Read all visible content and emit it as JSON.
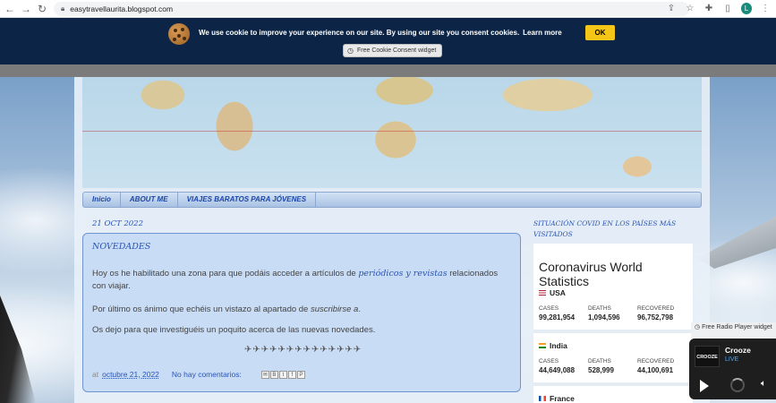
{
  "browser": {
    "url": "easytravellaurita.blogspot.com",
    "profile_initial": "L"
  },
  "cookie": {
    "message": "We use cookie to improve your experience on our site. By using our site you consent cookies.",
    "learn_more": "Learn more",
    "ok_label": "OK",
    "widget_label": "Free Cookie Consent widget"
  },
  "nav": {
    "items": [
      "Inicio",
      "ABOUT ME",
      "VIAJES BARATOS PARA JÓVENES"
    ]
  },
  "post": {
    "date_header": "21 OCT 2022",
    "title": "NOVEDADES",
    "p1_a": "Hoy os he habilitado una zona para que podáis acceder a artículos de ",
    "p1_b": "periódicos y revistas",
    "p1_c": " relacionados con viajar.",
    "p2_a": "Por último os ánimo que echéis un vistazo al apartado de ",
    "p2_b": "suscribirse a",
    "p2_c": ".",
    "p3": "Os dejo para que investiguéis un poquito acerca de las nuevas novedades.",
    "planes": "✈✈✈✈✈✈✈✈✈✈✈✈✈✈",
    "footer_at": "at",
    "footer_date": "octubre 21, 2022",
    "footer_comments": "No hay comentarios:"
  },
  "sidebar": {
    "title": "SITUACIÓN COVID EN LOS PAÍSES MÁS VISITADOS",
    "widget_title": "Coronavirus World Statistics",
    "countries": [
      {
        "name": "USA",
        "cases": "99,281,954",
        "deaths": "1,094,596",
        "recovered": "96,752,798"
      },
      {
        "name": "India",
        "cases": "44,649,088",
        "deaths": "528,999",
        "recovered": "44,100,691"
      },
      {
        "name": "France"
      }
    ],
    "labels": {
      "cases": "CASES",
      "deaths": "DEATHS",
      "recovered": "RECOVERED"
    }
  },
  "radio": {
    "widget_label": "Free Radio Player widget",
    "logo": "CROOZE",
    "station": "Crooze",
    "status": "LIVE"
  }
}
